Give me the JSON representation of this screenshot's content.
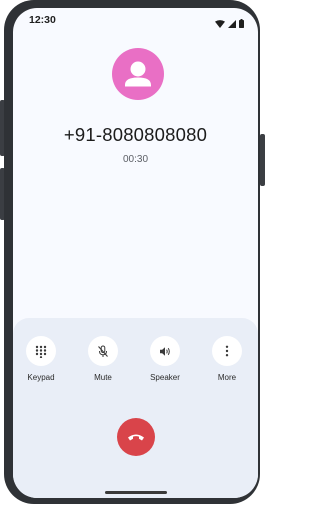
{
  "status_bar": {
    "time": "12:30"
  },
  "call": {
    "number": "+91-8080808080",
    "duration": "00:30"
  },
  "actions": [
    {
      "label": "Keypad",
      "icon": "dialpad-icon"
    },
    {
      "label": "Mute",
      "icon": "mic-off-icon"
    },
    {
      "label": "Speaker",
      "icon": "volume-icon"
    },
    {
      "label": "More",
      "icon": "more-vert-icon"
    }
  ],
  "colors": {
    "avatar": "#e96fc5",
    "end_call": "#d9444a",
    "panel": "#e9eef7",
    "screen_bg": "#f8faff"
  }
}
